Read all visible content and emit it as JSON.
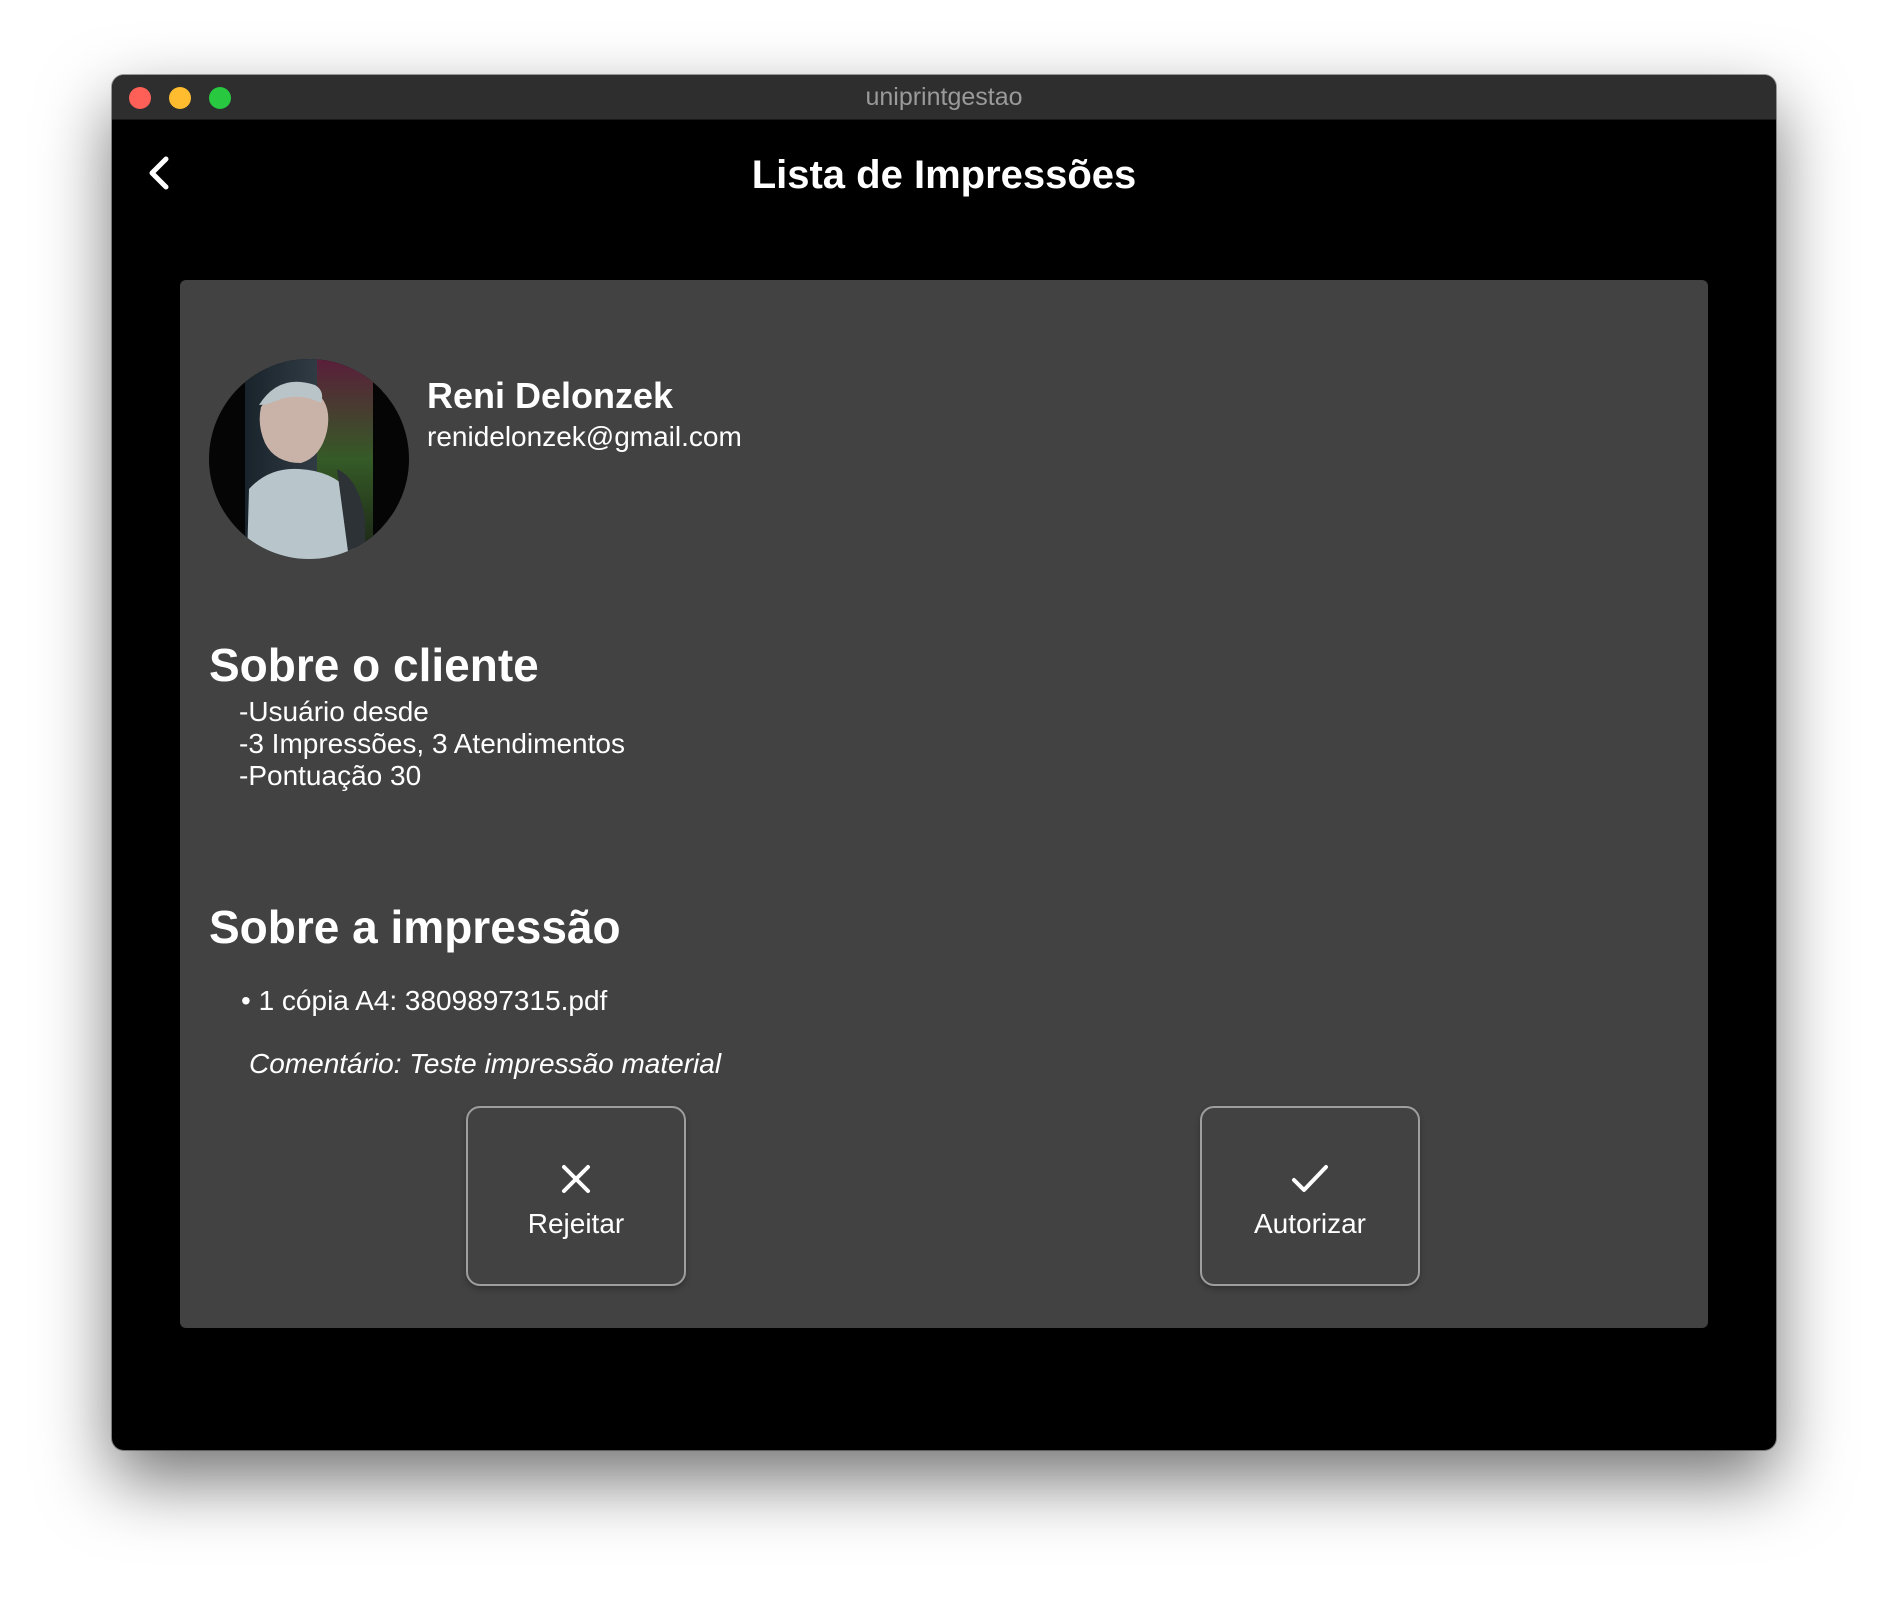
{
  "window": {
    "title": "uniprintgestao"
  },
  "appbar": {
    "title": "Lista de Impressões",
    "back_icon": "chevron-left-icon"
  },
  "client": {
    "name": "Reni Delonzek",
    "email": "renidelonzek@gmail.com"
  },
  "about_client": {
    "heading": "Sobre o cliente",
    "lines": [
      "-Usuário desde",
      "-3 Impressões, 3 Atendimentos",
      "-Pontuação 30"
    ]
  },
  "about_print": {
    "heading": "Sobre a impressão",
    "item": "• 1 cópia A4: 3809897315.pdf",
    "comment": "Comentário: Teste impressão material"
  },
  "actions": {
    "reject": {
      "label": "Rejeitar",
      "icon": "close-icon"
    },
    "authorize": {
      "label": "Autorizar",
      "icon": "check-icon"
    }
  },
  "colors": {
    "background": "#000000",
    "card": "#424242",
    "text": "#ffffff",
    "button_border": "#9e9e9e"
  }
}
